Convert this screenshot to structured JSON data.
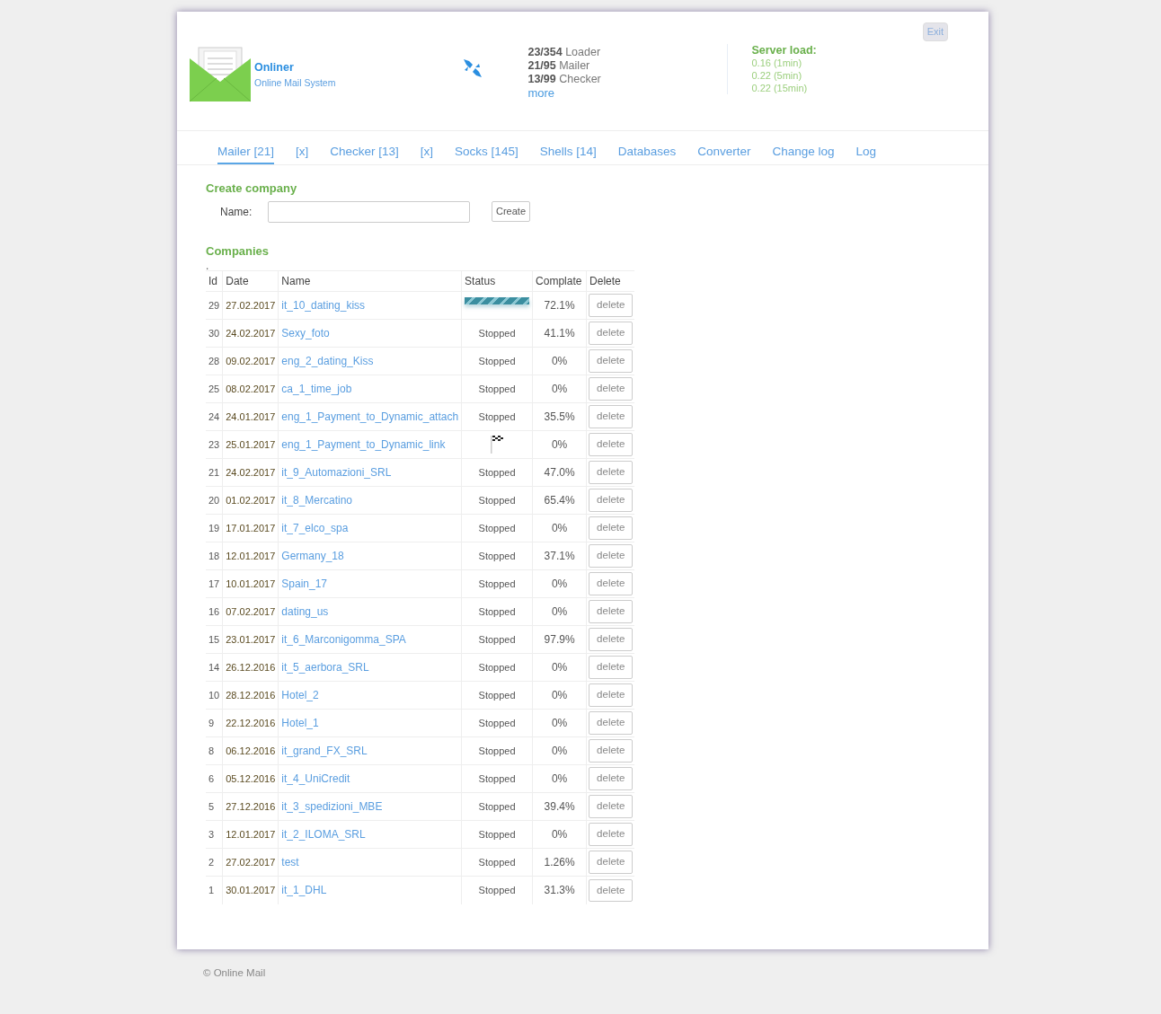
{
  "header": {
    "brand": "Onliner",
    "tagline": "Online Mail System",
    "counters": [
      {
        "count": "23/354",
        "label": "Loader"
      },
      {
        "count": "21/95",
        "label": "Mailer"
      },
      {
        "count": "13/99",
        "label": "Checker"
      }
    ],
    "more_link": "more",
    "server_load": {
      "title": "Server load:",
      "lines": [
        "0.16 (1min)",
        "0.22 (5min)",
        "0.22 (15min)"
      ]
    },
    "exit_button": "Exit"
  },
  "tabs": [
    {
      "label": "Mailer [21]",
      "selected": true
    },
    {
      "label": "[x]",
      "selected": false
    },
    {
      "label": "Checker [13]",
      "selected": false
    },
    {
      "label": "[x]",
      "selected": false
    },
    {
      "label": "Socks [145]",
      "selected": false
    },
    {
      "label": "Shells [14]",
      "selected": false
    },
    {
      "label": "Databases",
      "selected": false
    },
    {
      "label": "Converter",
      "selected": false
    },
    {
      "label": "Change log",
      "selected": false
    },
    {
      "label": "Log",
      "selected": false
    }
  ],
  "create_company": {
    "title": "Create company",
    "name_label": "Name:",
    "button": "Create"
  },
  "companies": {
    "title": "Companies",
    "note": ".",
    "columns": [
      "Id",
      "Date",
      "Name",
      "Status",
      "Complate",
      "Delete"
    ],
    "rows": [
      {
        "id": "29",
        "date": "27.02.2017",
        "name": "it_10_dating_kiss",
        "status": {
          "kind": "running"
        },
        "complete": "72.1%",
        "delete": "delete"
      },
      {
        "id": "30",
        "date": "24.02.2017",
        "name": "Sexy_foto",
        "status": {
          "kind": "text",
          "text": "Stopped"
        },
        "complete": "41.1%",
        "delete": "delete"
      },
      {
        "id": "28",
        "date": "09.02.2017",
        "name": "eng_2_dating_Kiss",
        "status": {
          "kind": "text",
          "text": "Stopped"
        },
        "complete": "0%",
        "delete": "delete"
      },
      {
        "id": "25",
        "date": "08.02.2017",
        "name": "ca_1_time_job",
        "status": {
          "kind": "text",
          "text": "Stopped"
        },
        "complete": "0%",
        "delete": "delete"
      },
      {
        "id": "24",
        "date": "24.01.2017",
        "name": "eng_1_Payment_to_Dynamic_attach",
        "status": {
          "kind": "text",
          "text": "Stopped"
        },
        "complete": "35.5%",
        "delete": "delete"
      },
      {
        "id": "23",
        "date": "25.01.2017",
        "name": "eng_1_Payment_to_Dynamic_link",
        "status": {
          "kind": "finished"
        },
        "complete": "0%",
        "delete": "delete"
      },
      {
        "id": "21",
        "date": "24.02.2017",
        "name": "it_9_Automazioni_SRL",
        "status": {
          "kind": "text",
          "text": "Stopped"
        },
        "complete": "47.0%",
        "delete": "delete"
      },
      {
        "id": "20",
        "date": "01.02.2017",
        "name": "it_8_Mercatino",
        "status": {
          "kind": "text",
          "text": "Stopped"
        },
        "complete": "65.4%",
        "delete": "delete"
      },
      {
        "id": "19",
        "date": "17.01.2017",
        "name": "it_7_elco_spa",
        "status": {
          "kind": "text",
          "text": "Stopped"
        },
        "complete": "0%",
        "delete": "delete"
      },
      {
        "id": "18",
        "date": "12.01.2017",
        "name": "Germany_18",
        "status": {
          "kind": "text",
          "text": "Stopped"
        },
        "complete": "37.1%",
        "delete": "delete"
      },
      {
        "id": "17",
        "date": "10.01.2017",
        "name": "Spain_17",
        "status": {
          "kind": "text",
          "text": "Stopped"
        },
        "complete": "0%",
        "delete": "delete"
      },
      {
        "id": "16",
        "date": "07.02.2017",
        "name": "dating_us",
        "status": {
          "kind": "text",
          "text": "Stopped"
        },
        "complete": "0%",
        "delete": "delete"
      },
      {
        "id": "15",
        "date": "23.01.2017",
        "name": "it_6_Marconigomma_SPA",
        "status": {
          "kind": "text",
          "text": "Stopped"
        },
        "complete": "97.9%",
        "delete": "delete"
      },
      {
        "id": "14",
        "date": "26.12.2016",
        "name": "it_5_aerbora_SRL",
        "status": {
          "kind": "text",
          "text": "Stopped"
        },
        "complete": "0%",
        "delete": "delete"
      },
      {
        "id": "10",
        "date": "28.12.2016",
        "name": "Hotel_2",
        "status": {
          "kind": "text",
          "text": "Stopped"
        },
        "complete": "0%",
        "delete": "delete"
      },
      {
        "id": "9",
        "date": "22.12.2016",
        "name": "Hotel_1",
        "status": {
          "kind": "text",
          "text": "Stopped"
        },
        "complete": "0%",
        "delete": "delete"
      },
      {
        "id": "8",
        "date": "06.12.2016",
        "name": "it_grand_FX_SRL",
        "status": {
          "kind": "text",
          "text": "Stopped"
        },
        "complete": "0%",
        "delete": "delete"
      },
      {
        "id": "6",
        "date": "05.12.2016",
        "name": "it_4_UniCredit",
        "status": {
          "kind": "text",
          "text": "Stopped"
        },
        "complete": "0%",
        "delete": "delete"
      },
      {
        "id": "5",
        "date": "27.12.2016",
        "name": "it_3_spedizioni_MBE",
        "status": {
          "kind": "text",
          "text": "Stopped"
        },
        "complete": "39.4%",
        "delete": "delete"
      },
      {
        "id": "3",
        "date": "12.01.2017",
        "name": "it_2_ILOMA_SRL",
        "status": {
          "kind": "text",
          "text": "Stopped"
        },
        "complete": "0%",
        "delete": "delete"
      },
      {
        "id": "2",
        "date": "27.02.2017",
        "name": "test",
        "status": {
          "kind": "text",
          "text": "Stopped"
        },
        "complete": "1.26%",
        "delete": "delete"
      },
      {
        "id": "1",
        "date": "30.01.2017",
        "name": "it_1_DHL",
        "status": {
          "kind": "text",
          "text": "Stopped"
        },
        "complete": "31.3%",
        "delete": "delete"
      }
    ]
  },
  "footer": "© Online Mail"
}
